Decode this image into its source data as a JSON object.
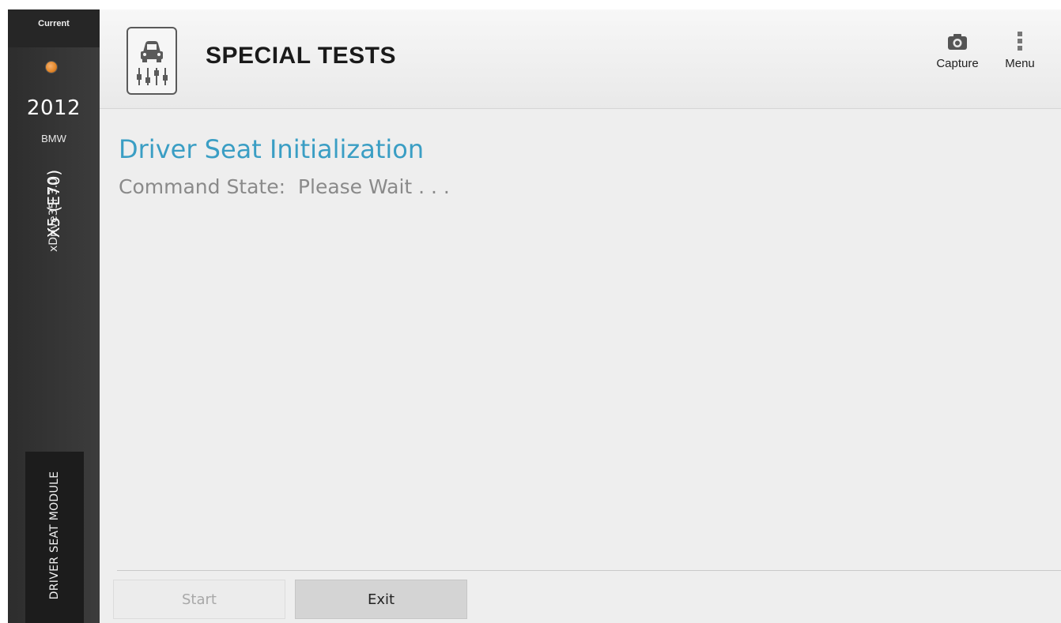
{
  "sidebar": {
    "current_label": "Current",
    "vci_icon": "vci-connector-icon",
    "year": "2012",
    "make": "BMW",
    "model": "X5 (E70)",
    "submodel": "xDrive35i 3.0",
    "module": "DRIVER SEAT MODULE"
  },
  "header": {
    "icon": "vehicle-test-icon",
    "title": "SPECIAL TESTS",
    "capture_label": "Capture",
    "capture_icon": "camera-icon",
    "menu_label": "Menu",
    "menu_icon": "vertical-dots-icon"
  },
  "main": {
    "test_title": "Driver Seat Initialization",
    "command_state": "Command State:  Please Wait . . ."
  },
  "footer": {
    "start_label": "Start",
    "exit_label": "Exit"
  },
  "colors": {
    "accent_blue": "#3a9ec4",
    "sidebar_bg": "#333333",
    "module_tab_bg": "#1c1c1c"
  }
}
